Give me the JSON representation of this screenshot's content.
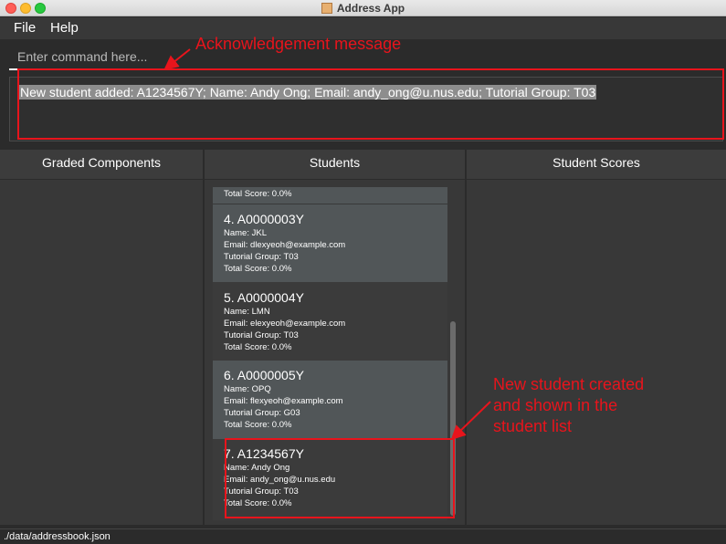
{
  "window": {
    "title": "Address App"
  },
  "menu": {
    "file": "File",
    "help": "Help"
  },
  "command": {
    "placeholder": "Enter command here..."
  },
  "result": {
    "message": "New student added: A1234567Y; Name: Andy Ong; Email: andy_ong@u.nus.edu; Tutorial Group: T03"
  },
  "panels": {
    "graded_components": "Graded Components",
    "students": "Students",
    "student_scores": "Student Scores"
  },
  "students": {
    "partial_score": "Total Score: 0.0%",
    "items": [
      {
        "title": "4.  A0000003Y",
        "name": "Name: JKL",
        "email": "Email: dlexyeoh@example.com",
        "tutorial": "Tutorial Group: T03",
        "score": "Total Score: 0.0%"
      },
      {
        "title": "5.  A0000004Y",
        "name": "Name: LMN",
        "email": "Email: elexyeoh@example.com",
        "tutorial": "Tutorial Group: T03",
        "score": "Total Score: 0.0%"
      },
      {
        "title": "6.  A0000005Y",
        "name": "Name: OPQ",
        "email": "Email: flexyeoh@example.com",
        "tutorial": "Tutorial Group: G03",
        "score": "Total Score: 0.0%"
      },
      {
        "title": "7.  A1234567Y",
        "name": "Name: Andy Ong",
        "email": "Email: andy_ong@u.nus.edu",
        "tutorial": "Tutorial Group: T03",
        "score": "Total Score: 0.0%"
      }
    ]
  },
  "status": {
    "path": "./data/addressbook.json"
  },
  "annotations": {
    "ack": "Acknowledgement message",
    "new_student_1": "New student created",
    "new_student_2": "and shown in the",
    "new_student_3": "student list",
    "color": "#e8141c"
  }
}
